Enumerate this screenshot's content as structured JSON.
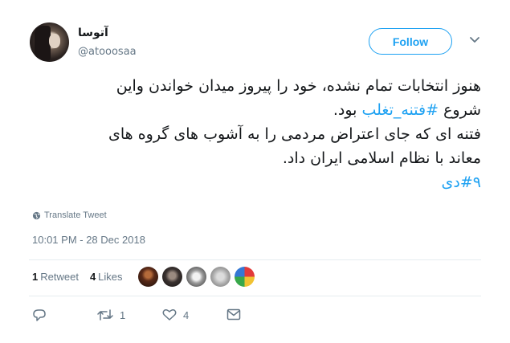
{
  "user": {
    "display_name": "آتوسا",
    "handle": "@atooosaa",
    "avatar_icon": "avatar"
  },
  "follow_label": "Follow",
  "tweet": {
    "lines": [
      "هنوز انتخابات تمام نشده، خود را پیروز میدان خواندن واین",
      "بود.",
      "فتنه ای که جای اعتراض مردمی را به آشوب های گروه های",
      "معاند با نظام اسلامی ایران داد."
    ],
    "line2_prefix": "شروع",
    "hashtag1": "#فتنه_تغلب",
    "hashtag2": "#۹دی"
  },
  "translate_label": "Translate Tweet",
  "timestamp": "10:01 PM - 28 Dec 2018",
  "stats": {
    "retweets_count": "1",
    "retweets_label": "Retweet",
    "likes_count": "4",
    "likes_label": "Likes"
  },
  "actions": {
    "reply_count": "",
    "retweet_count": "1",
    "like_count": "4"
  },
  "colors": {
    "accent": "#1da1f2",
    "muted": "#657786",
    "text": "#14171a"
  }
}
